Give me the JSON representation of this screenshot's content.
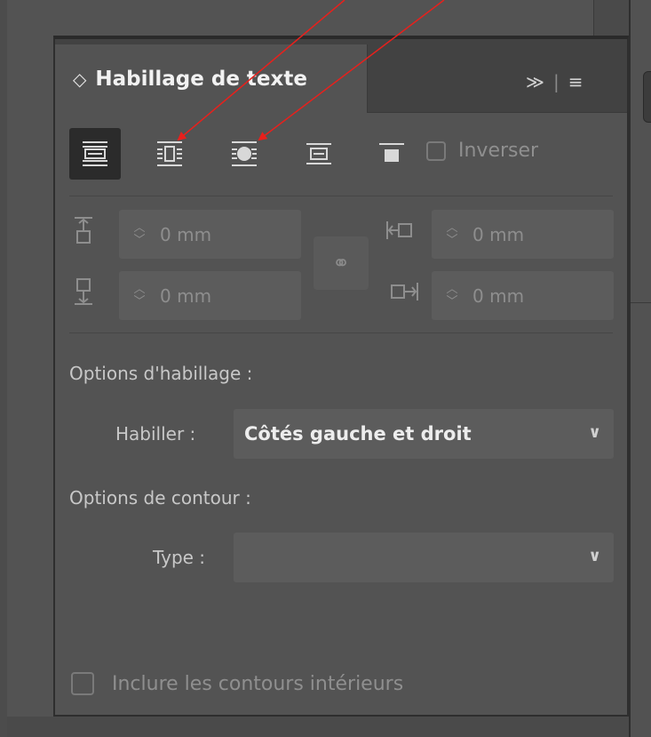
{
  "panel": {
    "title": "Habillage de texte",
    "collapse_glyph": "≫",
    "separator_glyph": "|",
    "menu_glyph": "≡"
  },
  "wrap_options": [
    {
      "name": "no-text-wrap",
      "icon": "no-wrap-icon",
      "active": true
    },
    {
      "name": "wrap-around-bounding-box",
      "icon": "bounding-box-wrap-icon",
      "active": false
    },
    {
      "name": "wrap-around-object-shape",
      "icon": "object-shape-wrap-icon",
      "active": false
    },
    {
      "name": "jump-object",
      "icon": "jump-object-icon",
      "active": false
    },
    {
      "name": "jump-to-next-column",
      "icon": "jump-to-next-column-icon",
      "active": false
    }
  ],
  "invert": {
    "label": "Inverser",
    "checked": false
  },
  "offsets": {
    "top": "0 mm",
    "bottom": "0 mm",
    "left": "0 mm",
    "right": "0 mm"
  },
  "wrap_options_section": {
    "heading": "Options d'habillage :",
    "wrap_to_label": "Habiller :",
    "wrap_to_value": "Côtés gauche et droit"
  },
  "contour_options_section": {
    "heading": "Options de contour :",
    "type_label": "Type :",
    "type_value": ""
  },
  "include_inside_edges": {
    "label": "Inclure les contours intérieurs",
    "checked": false
  },
  "colors": {
    "panel_bg": "#535353",
    "tab_bar_bg": "#424242",
    "field_bg": "#5c5c5c",
    "annotation_arrow": "#e8201c"
  }
}
